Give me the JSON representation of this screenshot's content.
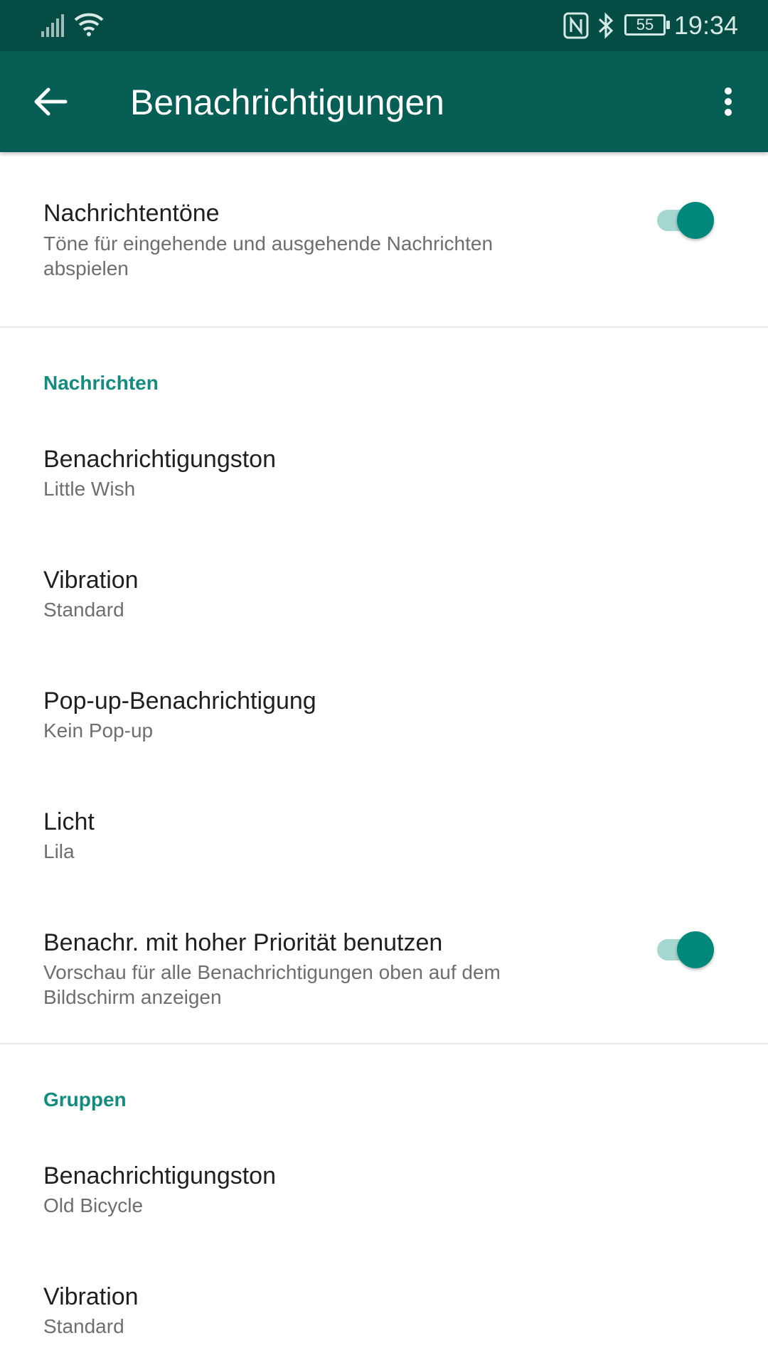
{
  "status_bar": {
    "time": "19:34",
    "battery": "55",
    "icons": [
      "signal-icon",
      "wifi-icon",
      "nfc-icon",
      "bluetooth-icon",
      "battery-icon"
    ]
  },
  "app_bar": {
    "title": "Benachrichtigungen",
    "back_icon": "arrow-back-icon",
    "menu_icon": "more-vert-icon"
  },
  "colors": {
    "status_bar": "#054d44",
    "app_bar": "#075e54",
    "accent": "#128c7e",
    "toggle_thumb": "#00897b",
    "toggle_track": "#a6d7d0"
  },
  "general": {
    "message_tones": {
      "title": "Nachrichtentöne",
      "summary": "Töne für eingehende und ausgehende Nachrichten abspielen",
      "enabled": true
    }
  },
  "messages": {
    "header": "Nachrichten",
    "notification_tone": {
      "title": "Benachrichtigungston",
      "value": "Little Wish"
    },
    "vibration": {
      "title": "Vibration",
      "value": "Standard"
    },
    "popup": {
      "title": "Pop-up-Benachrichtigung",
      "value": "Kein Pop-up"
    },
    "light": {
      "title": "Licht",
      "value": "Lila"
    },
    "high_priority": {
      "title": "Benachr. mit hoher Priorität benutzen",
      "summary": "Vorschau für alle Benachrichtigungen oben auf dem Bildschirm anzeigen",
      "enabled": true
    }
  },
  "groups": {
    "header": "Gruppen",
    "notification_tone": {
      "title": "Benachrichtigungston",
      "value": "Old Bicycle"
    },
    "vibration": {
      "title": "Vibration",
      "value": "Standard"
    }
  }
}
